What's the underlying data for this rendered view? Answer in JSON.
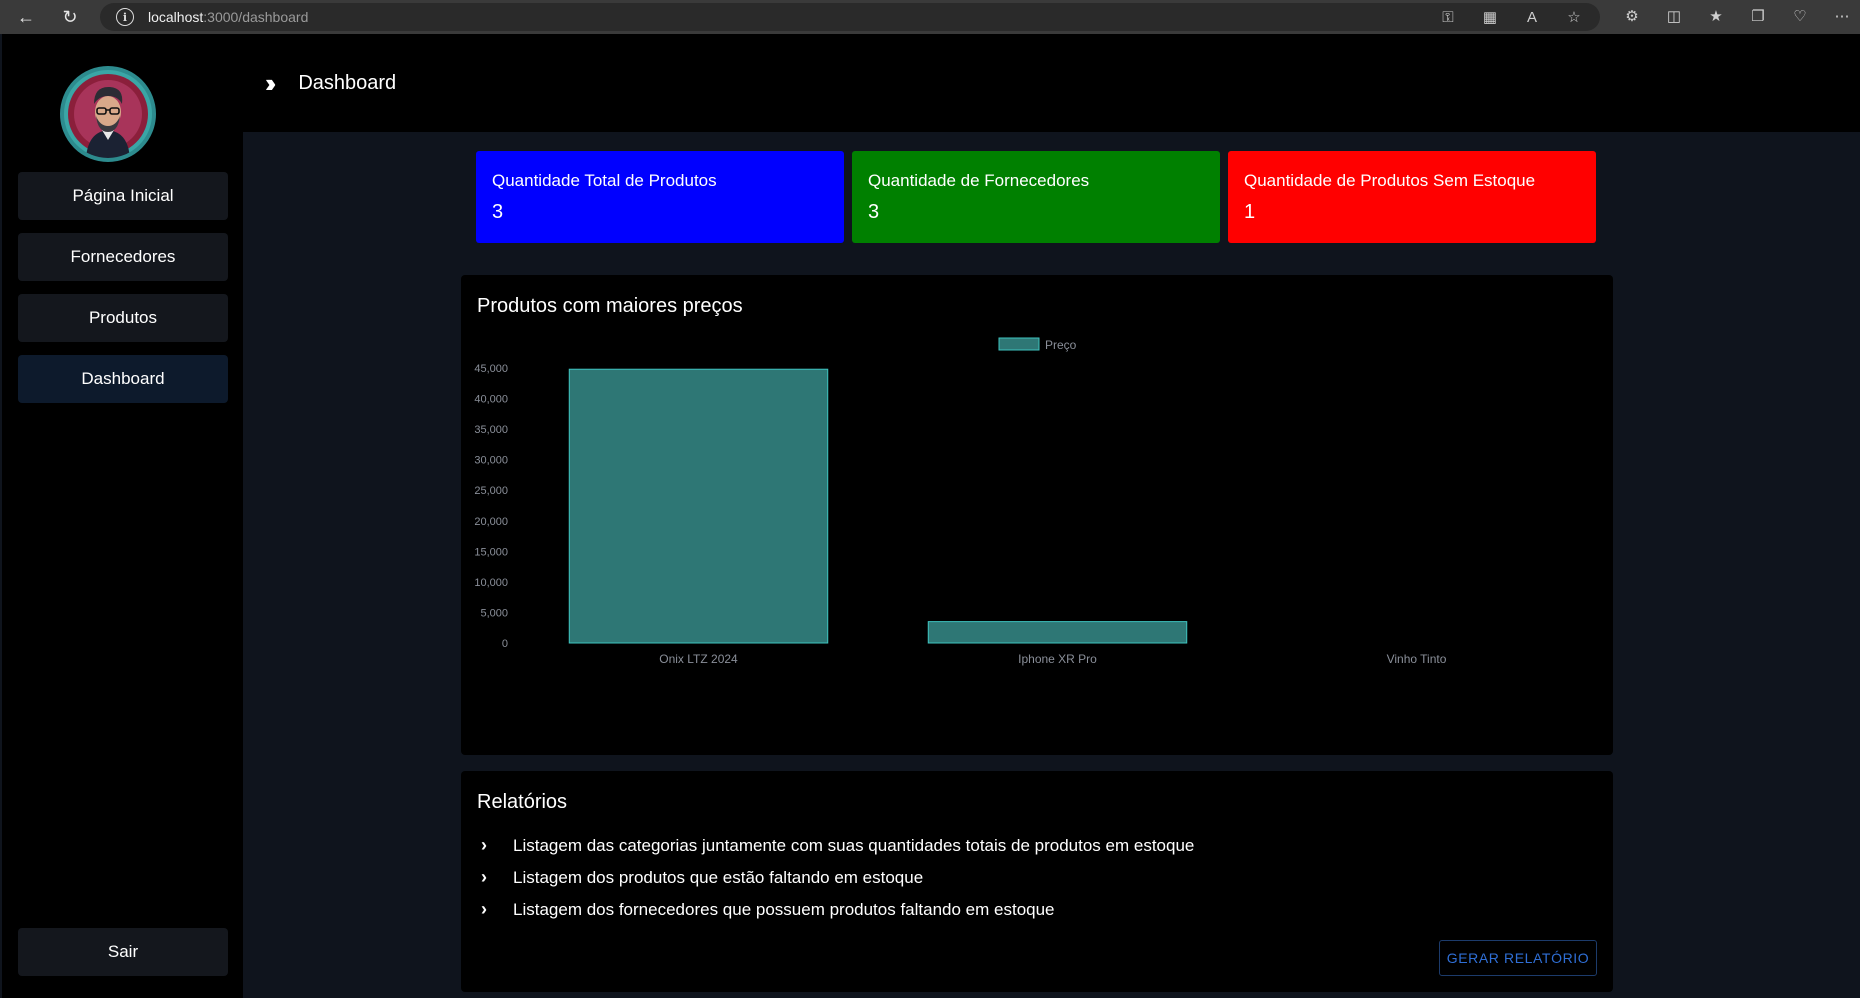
{
  "browser": {
    "url_host": "localhost",
    "url_rest": ":3000/dashboard"
  },
  "header": {
    "title": "Dashboard"
  },
  "sidebar": {
    "items": [
      {
        "label": "Página Inicial"
      },
      {
        "label": "Fornecedores"
      },
      {
        "label": "Produtos"
      },
      {
        "label": "Dashboard"
      }
    ],
    "logout_label": "Sair"
  },
  "cards": [
    {
      "label": "Quantidade Total de Produtos",
      "value": "3",
      "color": "#0000ff"
    },
    {
      "label": "Quantidade de Fornecedores",
      "value": "3",
      "color": "#008000"
    },
    {
      "label": "Quantidade de Produtos Sem Estoque",
      "value": "1",
      "color": "#ff0000"
    }
  ],
  "chart_panel": {
    "title": "Produtos com maiores preços"
  },
  "chart_data": {
    "type": "bar",
    "categories": [
      "Onix LTZ 2024",
      "Iphone XR Pro",
      "Vinho Tinto"
    ],
    "series": [
      {
        "name": "Preço",
        "values": [
          44800,
          3500,
          0
        ]
      }
    ],
    "ylim": [
      0,
      45000
    ],
    "yticks": [
      "0",
      "5,000",
      "10,000",
      "15,000",
      "20,000",
      "25,000",
      "30,000",
      "35,000",
      "40,000",
      "45,000"
    ],
    "legend_position": "top-center",
    "bar_color": "#2e7775",
    "bar_border": "#3ec4c0",
    "grid": false
  },
  "reports": {
    "title": "Relatórios",
    "items": [
      "Listagem das categorias juntamente com suas quantidades totais de produtos em estoque",
      "Listagem dos produtos que estão faltando em estoque",
      "Listagem dos fornecedores que possuem produtos faltando em estoque"
    ],
    "button_label": "GERAR RELATÓRIO"
  }
}
